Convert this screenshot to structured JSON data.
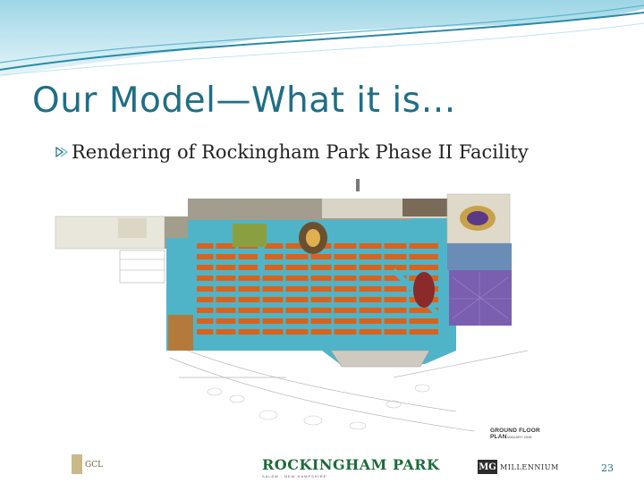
{
  "slide": {
    "title": "Our Model—What it is…",
    "bullet": "Rendering of Rockingham Park Phase II Facility",
    "page_number": "23"
  },
  "rendering": {
    "plan_label": "GROUND FLOOR PLAN",
    "plan_date": "JANUARY 2008",
    "logos": {
      "left": "GCL",
      "center_name": "ROCKINGHAM PARK",
      "center_sub": "SALEM · NEW HAMPSHIRE",
      "right_mark": "MG",
      "right_name": "MILLENNIUM"
    }
  },
  "colors": {
    "title": "#1f6e86",
    "header_wave_dark": "#2a8aa8",
    "header_wave_light": "#bfe4ef",
    "gaming_floor": "#d9621c",
    "walkways": "#4fb4c8",
    "purple_hall": "#7a5fb0"
  },
  "icons": [
    "bullet-arrow-icon"
  ]
}
